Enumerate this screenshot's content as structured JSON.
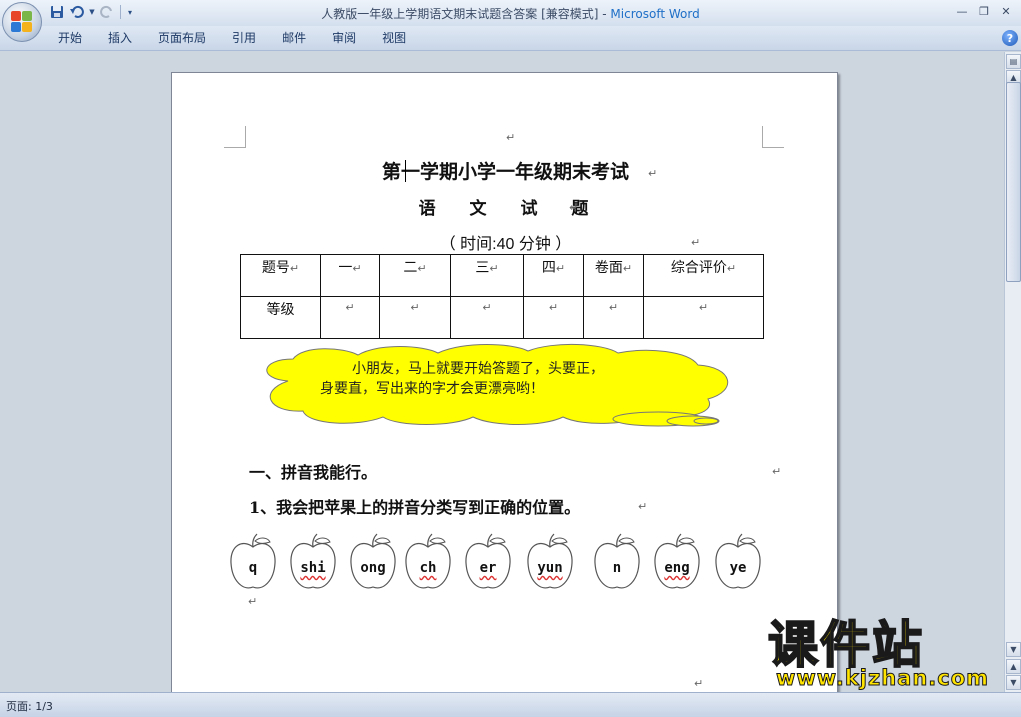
{
  "window": {
    "title": "人教版一年级上学期语文期末试题含答案 [兼容模式] - ",
    "app_name": "Microsoft Word"
  },
  "ribbon": {
    "tabs": [
      "开始",
      "插入",
      "页面布局",
      "引用",
      "邮件",
      "审阅",
      "视图"
    ]
  },
  "document": {
    "title": "第一学期小学一年级期末考试",
    "subtitle": "语 文 试 题",
    "time": "（ 时间:40 分钟 ）",
    "table": {
      "header": [
        "题号",
        "一",
        "二",
        "三",
        "四",
        "卷面",
        "综合评价"
      ],
      "row": [
        "等级",
        "",
        "",
        "",
        "",
        "",
        ""
      ]
    },
    "cloud_text": {
      "line1": "小朋友，马上就要开始答题了，头要正，",
      "line2": "身要直，写出来的字才会更漂亮哟！"
    },
    "section1": "一、拼音我能行。",
    "question1": "1、我会把苹果上的拼音分类写到正确的位置。",
    "apples": [
      "q",
      "shi",
      "ong",
      "ch",
      "er",
      "yun",
      "n",
      "eng",
      "ye"
    ]
  },
  "status": {
    "page": "页面: 1/3"
  },
  "watermark": {
    "chinese": "课件站",
    "url": "www.kjzhan.com"
  },
  "colors": {
    "cloud_fill": "#ffff00",
    "title_app": "#1e6fc7",
    "watermark": "#ffe400"
  }
}
